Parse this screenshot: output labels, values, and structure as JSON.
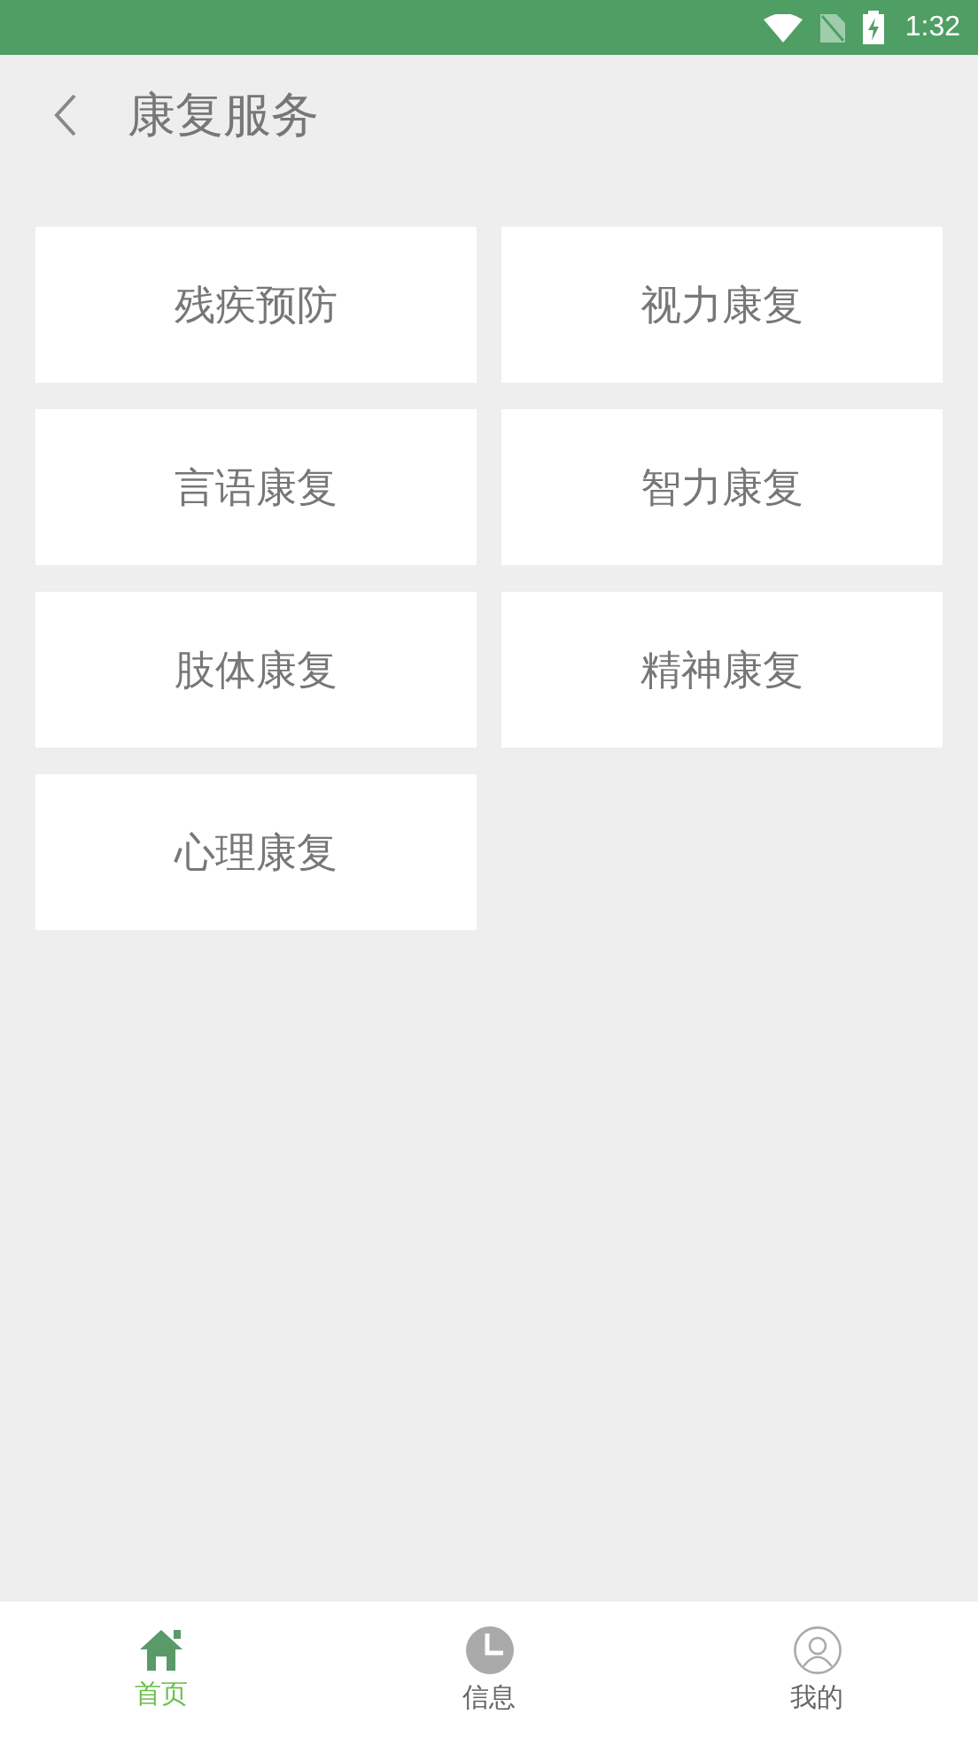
{
  "status_bar": {
    "time": "1:32"
  },
  "header": {
    "title": "康复服务"
  },
  "services": [
    {
      "label": "残疾预防"
    },
    {
      "label": "视力康复"
    },
    {
      "label": "言语康复"
    },
    {
      "label": "智力康复"
    },
    {
      "label": "肢体康复"
    },
    {
      "label": "精神康复"
    },
    {
      "label": "心理康复"
    }
  ],
  "bottom_nav": [
    {
      "label": "首页",
      "kind": "home",
      "selected": true
    },
    {
      "label": "信息",
      "kind": "clock",
      "selected": false
    },
    {
      "label": "我的",
      "kind": "user",
      "selected": false
    }
  ]
}
